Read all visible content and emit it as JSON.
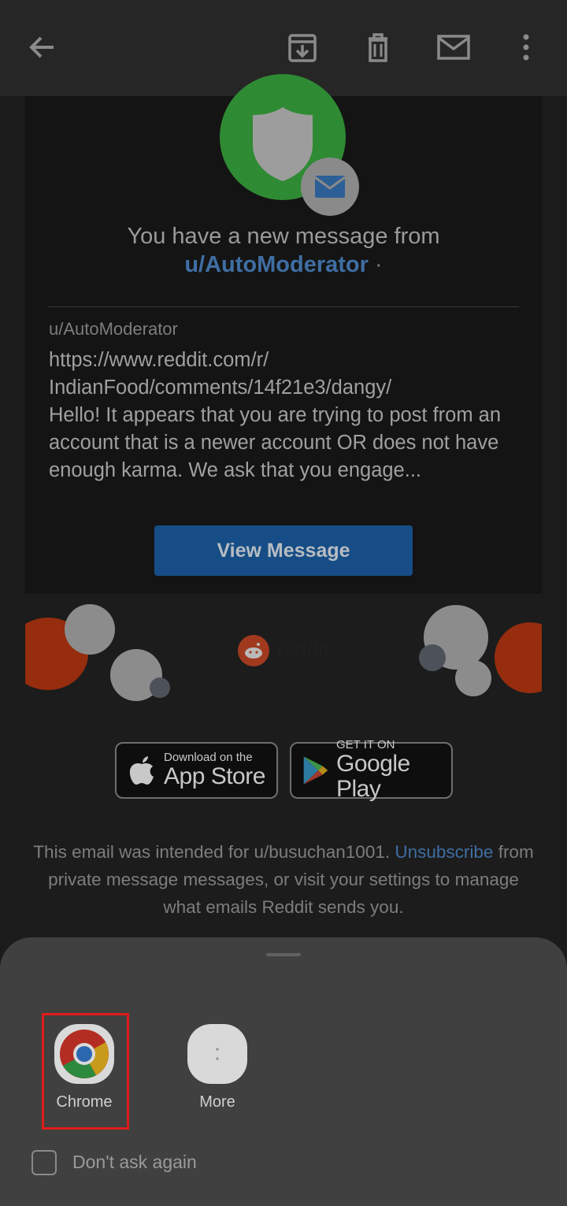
{
  "toolbar": {
    "back_icon": "arrow-left-icon",
    "archive_icon": "archive-icon",
    "delete_icon": "trash-icon",
    "mark_unread_icon": "mail-icon",
    "more_icon": "more-vert-icon"
  },
  "email": {
    "headline_line1": "You have a new message from",
    "headline_user": "u/AutoModerator",
    "headline_dot": "·",
    "sender": "u/AutoModerator",
    "snippet": "https://www.reddit.com/r/\nIndianFood/comments/14f21e3/dangy/\nHello! It appears that you are trying to post from an account that is a newer account OR does not have enough karma. We ask that you engage...",
    "view_button": "View Message",
    "reddit_wordmark": "reddit",
    "app_store_small": "Download on the",
    "app_store_big": "App Store",
    "google_play_small": "GET IT ON",
    "google_play_big": "Google Play",
    "legal_prefix": "This email was intended for u/busuchan1001.",
    "legal_link": "Unsubscribe",
    "legal_suffix": "from private message messages, or visit your settings to manage what emails Reddit sends you."
  },
  "chooser": {
    "apps": [
      {
        "label": "Chrome",
        "icon": "chrome-icon"
      },
      {
        "label": "More",
        "icon": "more-icon"
      }
    ],
    "checkbox_label": "Don't ask again",
    "checkbox_checked": false
  },
  "colors": {
    "link_blue": "#3f6ea3",
    "button_blue": "#164d86",
    "highlight_red": "#e01b1b"
  }
}
